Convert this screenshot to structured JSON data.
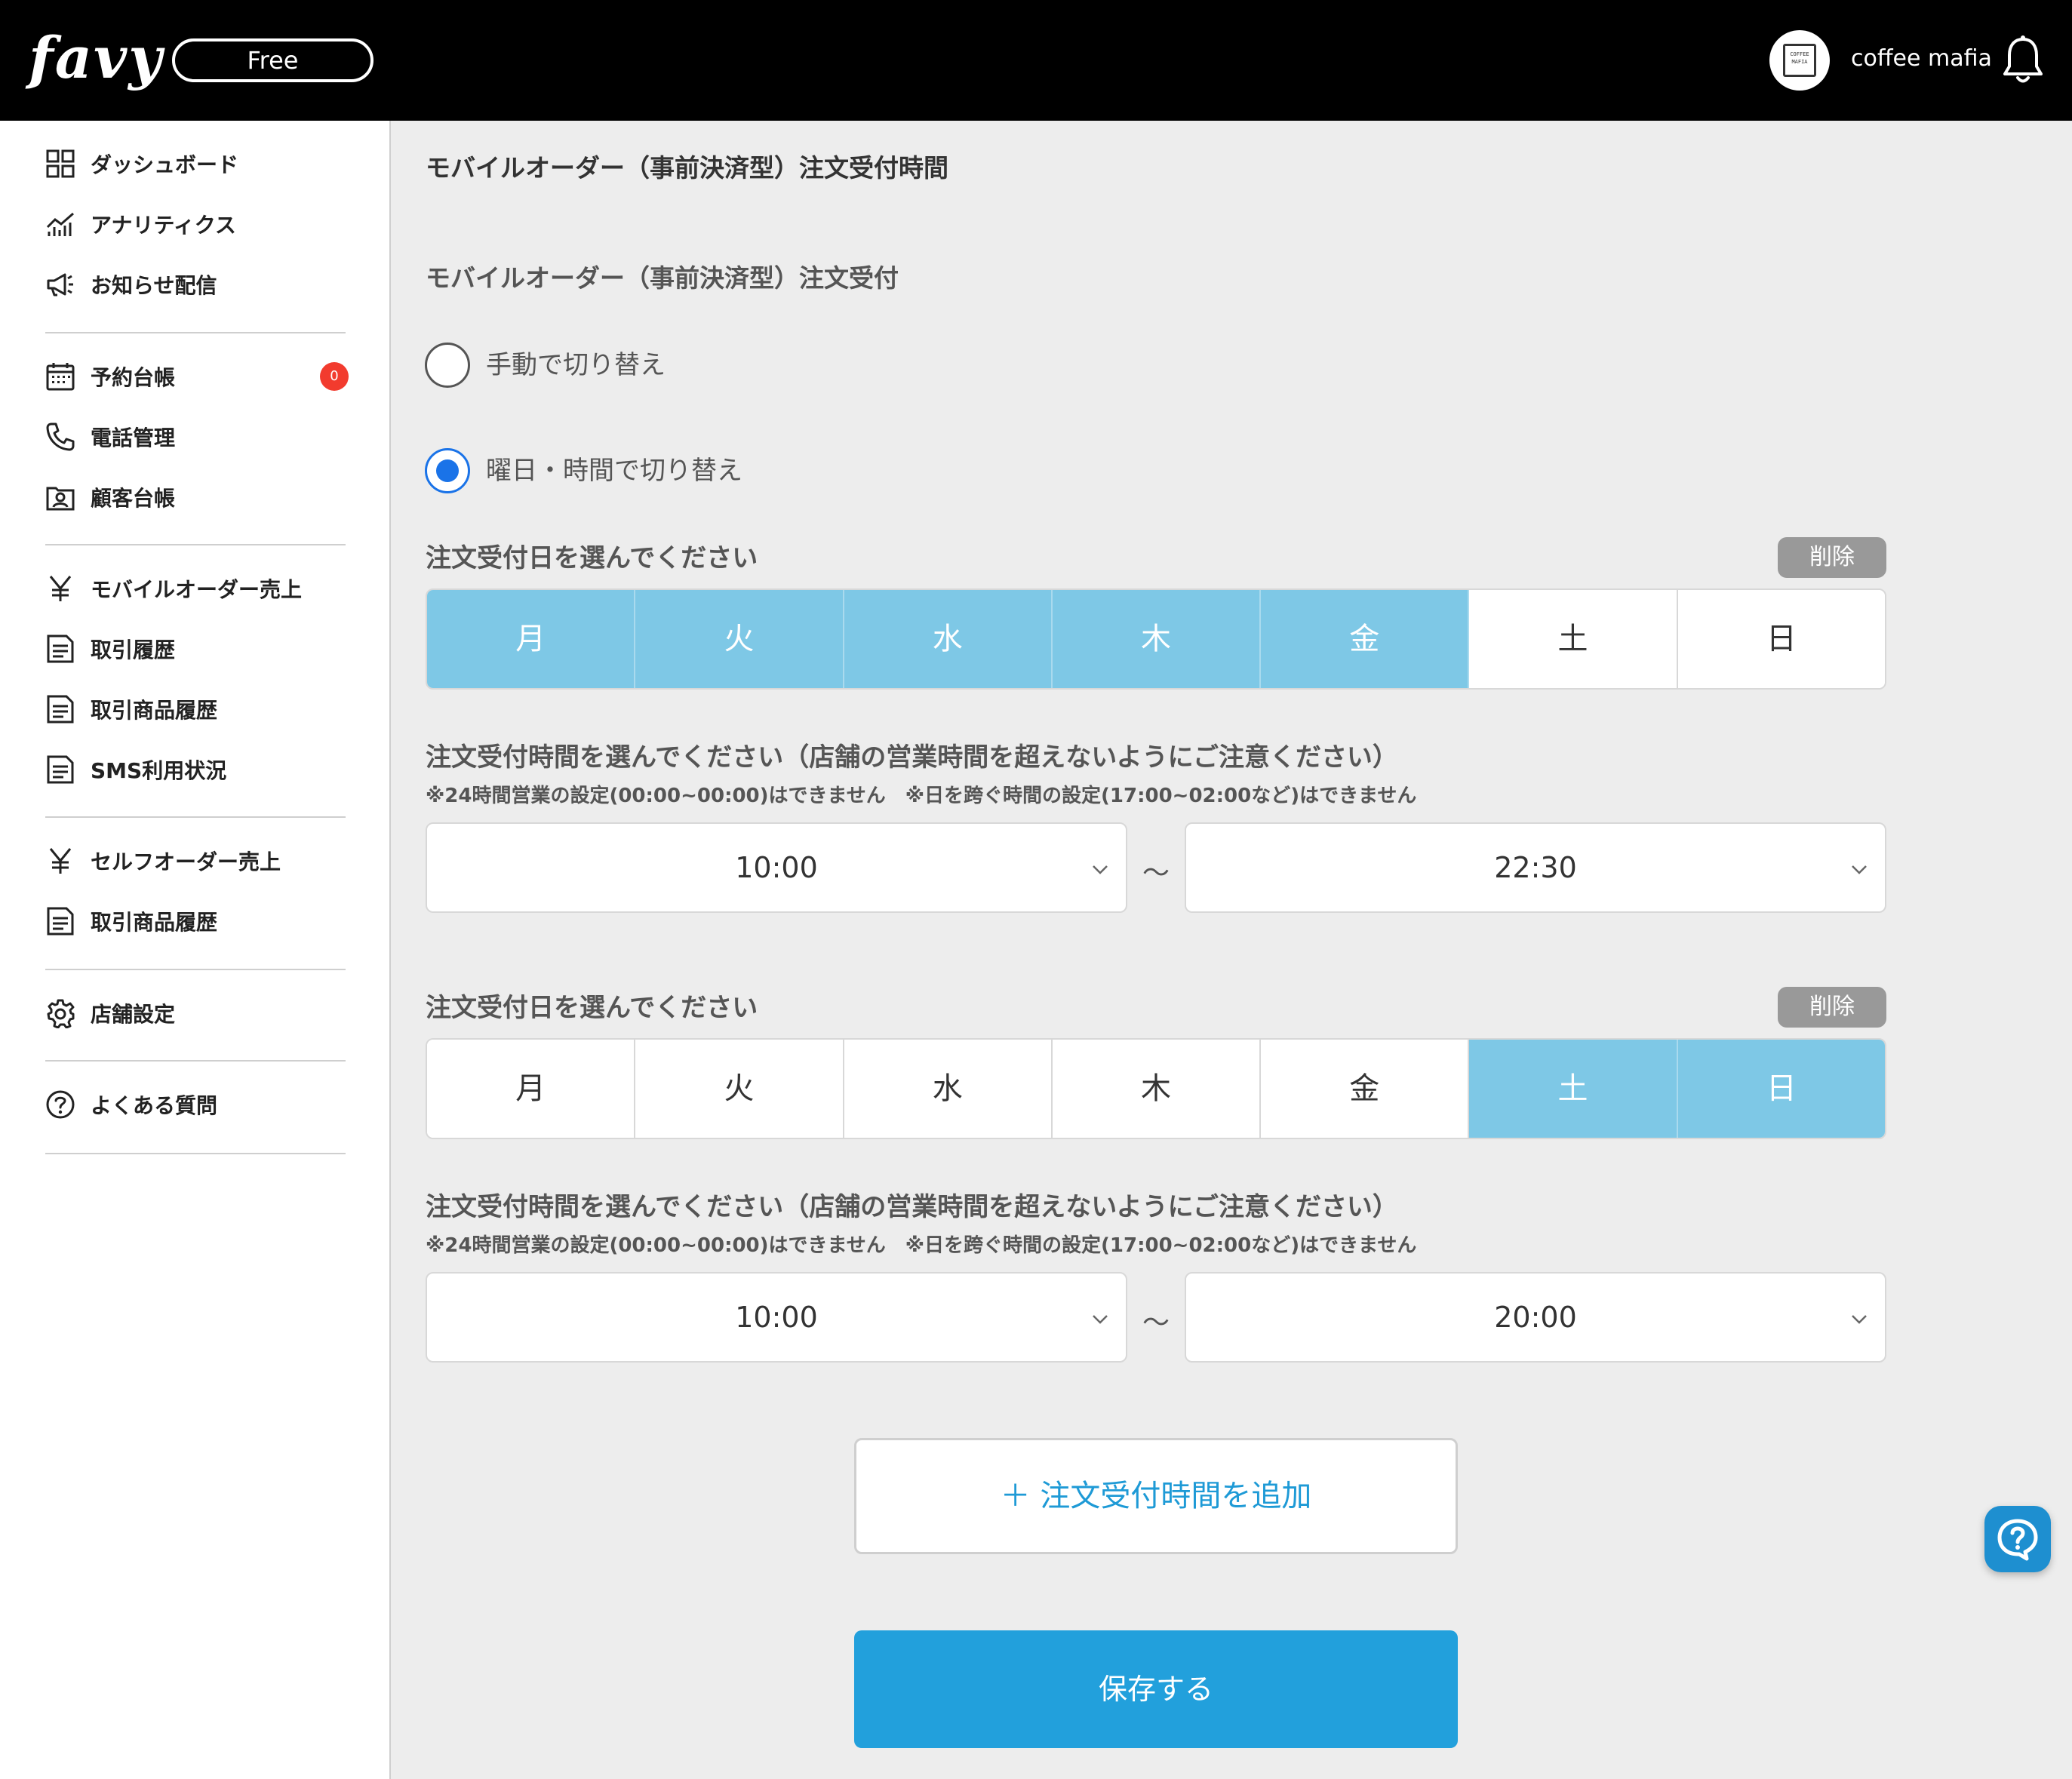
{
  "header": {
    "logo": "favy",
    "plan": "Free",
    "avatar_text": "COFFEE MAFIA",
    "shop_name": "coffee mafia"
  },
  "sidebar": {
    "items": [
      {
        "label": "ダッシュボード",
        "icon": "grid-icon"
      },
      {
        "label": "アナリティクス",
        "icon": "chart-icon"
      },
      {
        "label": "お知らせ配信",
        "icon": "megaphone-icon"
      },
      {
        "label": "予約台帳",
        "icon": "calendar-icon",
        "badge": "0"
      },
      {
        "label": "電話管理",
        "icon": "phone-icon"
      },
      {
        "label": "顧客台帳",
        "icon": "contact-card-icon"
      },
      {
        "label": "モバイルオーダー売上",
        "icon": "yen-icon"
      },
      {
        "label": "取引履歴",
        "icon": "document-icon"
      },
      {
        "label": "取引商品履歴",
        "icon": "document-icon"
      },
      {
        "label": "SMS利用状況",
        "icon": "document-icon"
      },
      {
        "label": "セルフオーダー売上",
        "icon": "yen-icon"
      },
      {
        "label": "取引商品履歴",
        "icon": "document-icon"
      },
      {
        "label": "店舗設定",
        "icon": "gear-icon"
      },
      {
        "label": "よくある質問",
        "icon": "question-icon"
      }
    ]
  },
  "main": {
    "title": "モバイルオーダー（事前決済型）注文受付時間",
    "section_title": "モバイルオーダー（事前決済型）注文受付",
    "radio_options": [
      {
        "label": "手動で切り替え",
        "checked": false
      },
      {
        "label": "曜日・時間で切り替え",
        "checked": true
      }
    ],
    "day_label": "注文受付日を選んでください",
    "delete_label": "削除",
    "days": [
      "月",
      "火",
      "水",
      "木",
      "金",
      "土",
      "日"
    ],
    "time_label": "注文受付時間を選んでください（店舗の営業時間を超えないようにご注意ください）",
    "time_note": "※24時間営業の設定(00:00~00:00)はできません　※日を跨ぐ時間の設定(17:00~02:00など)はできません",
    "separator": "〜",
    "schedules": [
      {
        "active_days": [
          true,
          true,
          true,
          true,
          true,
          false,
          false
        ],
        "start": "10:00",
        "end": "22:30"
      },
      {
        "active_days": [
          false,
          false,
          false,
          false,
          false,
          true,
          true
        ],
        "start": "10:00",
        "end": "20:00"
      }
    ],
    "add_button": "＋ 注文受付時間を追加",
    "save_button": "保存する"
  },
  "colors": {
    "header_bg": "#000000",
    "accent": "#22a0dc",
    "day_active": "#7ec8e6",
    "badge": "#f23b2e",
    "radio_checked": "#1a73e8"
  }
}
